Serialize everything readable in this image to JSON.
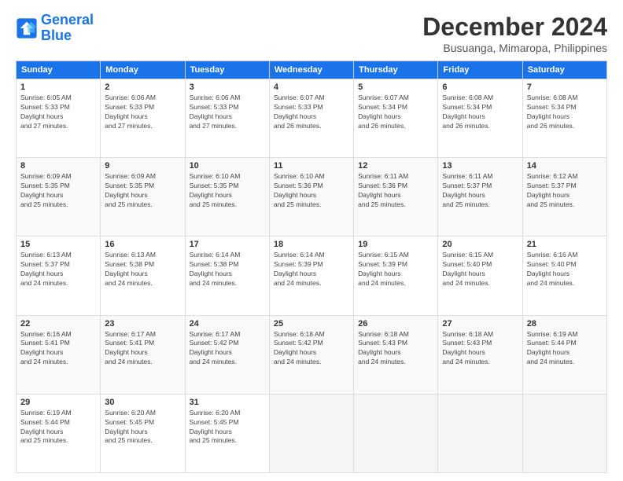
{
  "logo": {
    "line1": "General",
    "line2": "Blue"
  },
  "title": "December 2024",
  "subtitle": "Busuanga, Mimaropa, Philippines",
  "weekdays": [
    "Sunday",
    "Monday",
    "Tuesday",
    "Wednesday",
    "Thursday",
    "Friday",
    "Saturday"
  ],
  "weeks": [
    [
      {
        "day": "1",
        "sunrise": "6:05 AM",
        "sunset": "5:33 PM",
        "daylight": "11 hours and 27 minutes."
      },
      {
        "day": "2",
        "sunrise": "6:06 AM",
        "sunset": "5:33 PM",
        "daylight": "11 hours and 27 minutes."
      },
      {
        "day": "3",
        "sunrise": "6:06 AM",
        "sunset": "5:33 PM",
        "daylight": "11 hours and 27 minutes."
      },
      {
        "day": "4",
        "sunrise": "6:07 AM",
        "sunset": "5:33 PM",
        "daylight": "11 hours and 26 minutes."
      },
      {
        "day": "5",
        "sunrise": "6:07 AM",
        "sunset": "5:34 PM",
        "daylight": "11 hours and 26 minutes."
      },
      {
        "day": "6",
        "sunrise": "6:08 AM",
        "sunset": "5:34 PM",
        "daylight": "11 hours and 26 minutes."
      },
      {
        "day": "7",
        "sunrise": "6:08 AM",
        "sunset": "5:34 PM",
        "daylight": "11 hours and 26 minutes."
      }
    ],
    [
      {
        "day": "8",
        "sunrise": "6:09 AM",
        "sunset": "5:35 PM",
        "daylight": "11 hours and 25 minutes."
      },
      {
        "day": "9",
        "sunrise": "6:09 AM",
        "sunset": "5:35 PM",
        "daylight": "11 hours and 25 minutes."
      },
      {
        "day": "10",
        "sunrise": "6:10 AM",
        "sunset": "5:35 PM",
        "daylight": "11 hours and 25 minutes."
      },
      {
        "day": "11",
        "sunrise": "6:10 AM",
        "sunset": "5:36 PM",
        "daylight": "11 hours and 25 minutes."
      },
      {
        "day": "12",
        "sunrise": "6:11 AM",
        "sunset": "5:36 PM",
        "daylight": "11 hours and 25 minutes."
      },
      {
        "day": "13",
        "sunrise": "6:11 AM",
        "sunset": "5:37 PM",
        "daylight": "11 hours and 25 minutes."
      },
      {
        "day": "14",
        "sunrise": "6:12 AM",
        "sunset": "5:37 PM",
        "daylight": "11 hours and 25 minutes."
      }
    ],
    [
      {
        "day": "15",
        "sunrise": "6:13 AM",
        "sunset": "5:37 PM",
        "daylight": "11 hours and 24 minutes."
      },
      {
        "day": "16",
        "sunrise": "6:13 AM",
        "sunset": "5:38 PM",
        "daylight": "11 hours and 24 minutes."
      },
      {
        "day": "17",
        "sunrise": "6:14 AM",
        "sunset": "5:38 PM",
        "daylight": "11 hours and 24 minutes."
      },
      {
        "day": "18",
        "sunrise": "6:14 AM",
        "sunset": "5:39 PM",
        "daylight": "11 hours and 24 minutes."
      },
      {
        "day": "19",
        "sunrise": "6:15 AM",
        "sunset": "5:39 PM",
        "daylight": "11 hours and 24 minutes."
      },
      {
        "day": "20",
        "sunrise": "6:15 AM",
        "sunset": "5:40 PM",
        "daylight": "11 hours and 24 minutes."
      },
      {
        "day": "21",
        "sunrise": "6:16 AM",
        "sunset": "5:40 PM",
        "daylight": "11 hours and 24 minutes."
      }
    ],
    [
      {
        "day": "22",
        "sunrise": "6:16 AM",
        "sunset": "5:41 PM",
        "daylight": "11 hours and 24 minutes."
      },
      {
        "day": "23",
        "sunrise": "6:17 AM",
        "sunset": "5:41 PM",
        "daylight": "11 hours and 24 minutes."
      },
      {
        "day": "24",
        "sunrise": "6:17 AM",
        "sunset": "5:42 PM",
        "daylight": "11 hours and 24 minutes."
      },
      {
        "day": "25",
        "sunrise": "6:18 AM",
        "sunset": "5:42 PM",
        "daylight": "11 hours and 24 minutes."
      },
      {
        "day": "26",
        "sunrise": "6:18 AM",
        "sunset": "5:43 PM",
        "daylight": "11 hours and 24 minutes."
      },
      {
        "day": "27",
        "sunrise": "6:18 AM",
        "sunset": "5:43 PM",
        "daylight": "11 hours and 24 minutes."
      },
      {
        "day": "28",
        "sunrise": "6:19 AM",
        "sunset": "5:44 PM",
        "daylight": "11 hours and 24 minutes."
      }
    ],
    [
      {
        "day": "29",
        "sunrise": "6:19 AM",
        "sunset": "5:44 PM",
        "daylight": "11 hours and 25 minutes."
      },
      {
        "day": "30",
        "sunrise": "6:20 AM",
        "sunset": "5:45 PM",
        "daylight": "11 hours and 25 minutes."
      },
      {
        "day": "31",
        "sunrise": "6:20 AM",
        "sunset": "5:45 PM",
        "daylight": "11 hours and 25 minutes."
      },
      null,
      null,
      null,
      null
    ]
  ]
}
